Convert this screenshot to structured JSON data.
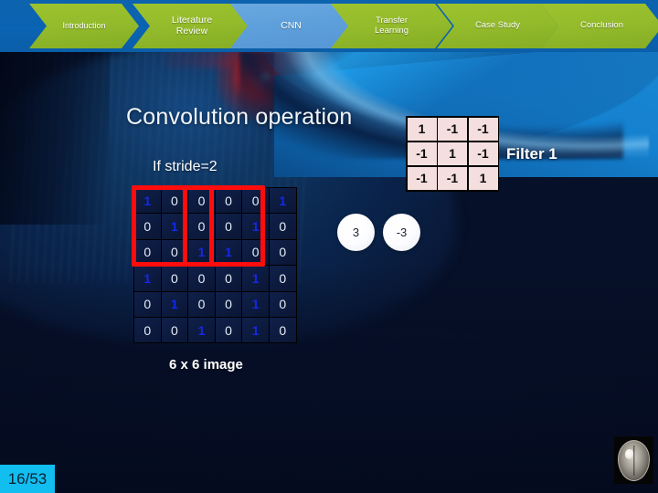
{
  "nav": {
    "items": [
      {
        "label": "Introduction",
        "state": "inactive",
        "color": "#93bb2b"
      },
      {
        "label": "Literature\nReview",
        "line1": "Literature",
        "line2": "Review",
        "state": "inactive",
        "color": "#93bb2b"
      },
      {
        "label": "CNN",
        "line1": "CNN",
        "line2": "",
        "state": "active",
        "color": "#5d9fdb"
      },
      {
        "label": "Transfer\nLearning",
        "line1": "Transfer",
        "line2": "Learning",
        "state": "inactive",
        "color": "#93bb2b"
      },
      {
        "label": "Case Study",
        "line1": "Case Study",
        "line2": "",
        "state": "inactive",
        "color": "#93bb2b"
      },
      {
        "label": "Conclusion",
        "line1": "Conclusion",
        "line2": "",
        "state": "inactive",
        "color": "#93bb2b"
      }
    ]
  },
  "slide": {
    "title": "Convolution operation",
    "stride_label": "If stride=2",
    "image_caption": "6 x 6 image",
    "filter_label": "Filter 1",
    "page_number": "16/53"
  },
  "image_matrix": {
    "rows": 6,
    "cols": 6,
    "values": [
      [
        1,
        0,
        0,
        0,
        0,
        1
      ],
      [
        0,
        1,
        0,
        0,
        1,
        0
      ],
      [
        0,
        0,
        1,
        1,
        0,
        0
      ],
      [
        1,
        0,
        0,
        0,
        1,
        0
      ],
      [
        0,
        1,
        0,
        0,
        1,
        0
      ],
      [
        0,
        0,
        1,
        0,
        1,
        0
      ]
    ],
    "highlight_color": "#ff0d0d",
    "highlights": [
      {
        "name": "window-1",
        "row": 0,
        "col": 0,
        "size": 3
      },
      {
        "name": "window-2",
        "row": 0,
        "col": 2,
        "size": 3
      }
    ]
  },
  "filter_matrix": {
    "rows": 3,
    "cols": 3,
    "values": [
      [
        1,
        -1,
        -1
      ],
      [
        -1,
        1,
        -1
      ],
      [
        -1,
        -1,
        1
      ]
    ]
  },
  "outputs": [
    {
      "name": "output-value-1",
      "value": "3"
    },
    {
      "name": "output-value-2",
      "value": "-3"
    }
  ]
}
